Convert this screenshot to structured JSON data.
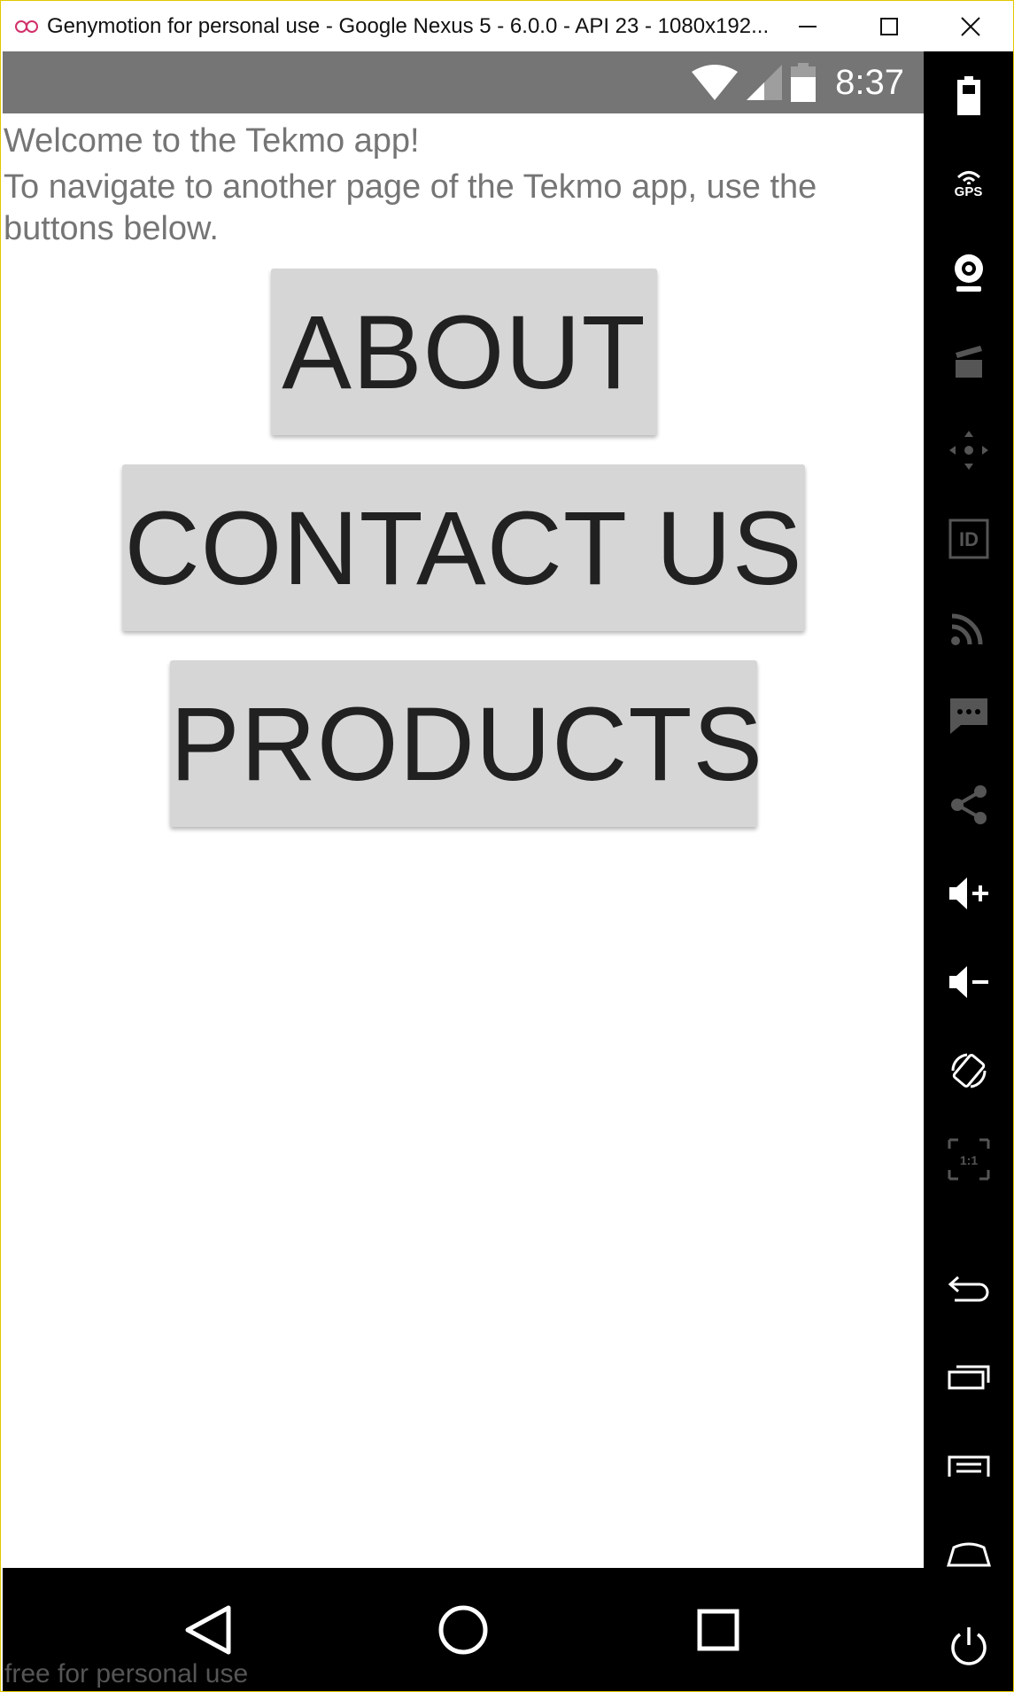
{
  "window": {
    "title": "Genymotion for personal use - Google Nexus 5 - 6.0.0 - API 23 - 1080x192...",
    "minimize_label": "minimize",
    "maximize_label": "maximize",
    "close_label": "close"
  },
  "statusbar": {
    "time": "8:37",
    "icons": [
      "wifi-icon",
      "cell-signal-icon",
      "battery-icon"
    ]
  },
  "app": {
    "welcome": "Welcome to the Tekmo app!",
    "instructions": "To navigate to another page of the Tekmo app, use the buttons below.",
    "buttons": {
      "about": "ABOUT",
      "contact": "CONTACT US",
      "products": "PRODUCTS"
    }
  },
  "navbar": {
    "items": [
      "back-icon",
      "home-icon",
      "recents-icon"
    ]
  },
  "watermark": "free for personal use",
  "toolbar": {
    "items": [
      "battery-icon",
      "gps-icon",
      "webcam-icon",
      "capture-icon",
      "dpad-icon",
      "device-id-icon",
      "cast-icon",
      "sms-icon",
      "share-icon",
      "volume-up-icon",
      "volume-down-icon",
      "rotate-icon",
      "pixel-perfect-icon",
      "back-icon",
      "recent-apps-icon",
      "menu-icon",
      "home-icon",
      "power-icon"
    ],
    "gps_label": "GPS",
    "id_label": "ID",
    "pixel_label": "1:1"
  },
  "colors": {
    "statusbar": "#757575",
    "button_bg": "#d6d6d6",
    "button_text": "#212121",
    "body_text": "#757575",
    "window_border": "#e3c800",
    "toolbar_bg": "#000000"
  }
}
